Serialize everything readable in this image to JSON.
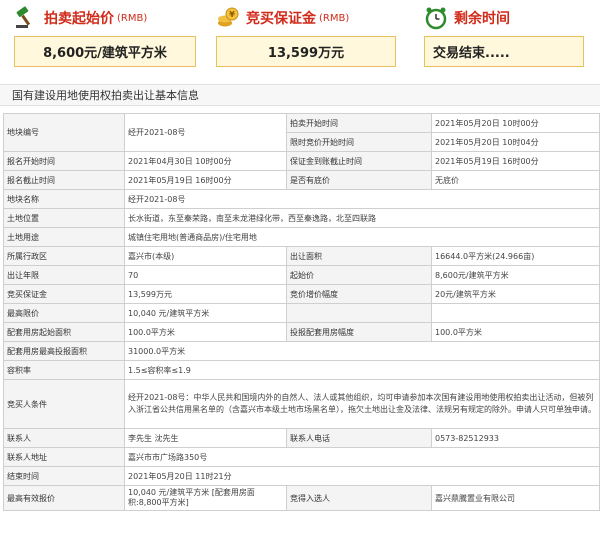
{
  "summary": {
    "start_price": {
      "title": "拍卖起始价",
      "unit": "(RMB)",
      "value": "8,600元/建筑平方米"
    },
    "deposit": {
      "title": "竞买保证金",
      "unit": "(RMB)",
      "value": "13,599万元"
    },
    "remaining": {
      "title": "剩余时间",
      "value": "交易结束....."
    }
  },
  "section_title": "国有建设用地使用权拍卖出让基本信息",
  "rows": [
    {
      "l1": "地块编号",
      "v1": "经开2021-08号",
      "l2": "拍卖开始时间",
      "v2": "2021年05月20日 10时00分"
    },
    {
      "l1": "",
      "v1": "",
      "l2": "限时竞价开始时间",
      "v2": "2021年05月20日 10时04分"
    },
    {
      "l1": "报名开始时间",
      "v1": "2021年04月30日 10时00分",
      "l2": "保证金到账截止时间",
      "v2": "2021年05月19日 16时00分"
    },
    {
      "l1": "报名截止时间",
      "v1": "2021年05月19日 16时00分",
      "l2": "是否有底价",
      "v2": "无底价"
    },
    {
      "l1": "地块名称",
      "v1": "经开2021-08号"
    },
    {
      "l1": "土地位置",
      "v1": "长水街道，东至秦荣路，南至未龙港绿化带，西至秦逸路，北至四联路"
    },
    {
      "l1": "土地用途",
      "v1": "城镇住宅用地(普通商品房)/住宅用地"
    },
    {
      "l1": "所属行政区",
      "v1": "嘉兴市(本级)",
      "l2": "出让面积",
      "v2": "16644.0平方米(24.966亩)"
    },
    {
      "l1": "出让年限",
      "v1": "70",
      "l2": "起始价",
      "v2": "8,600元/建筑平方米"
    },
    {
      "l1": "竞买保证金",
      "v1": "13,599万元",
      "l2": "竞价增价幅度",
      "v2": "20元/建筑平方米"
    },
    {
      "l1": "最高限价",
      "v1": "10,040 元/建筑平方米",
      "l2": "",
      "v2": ""
    },
    {
      "l1": "配套用房起始面积",
      "v1": "100.0平方米",
      "l2": "投报配套用房幅度",
      "v2": "100.0平方米"
    },
    {
      "l1": "配套用房最高投报面积",
      "v1": "31000.0平方米"
    },
    {
      "l1": "容积率",
      "v1": "1.5≤容积率≤1.9"
    },
    {
      "l1": "竞买人条件",
      "v1": "经开2021-08号：中华人民共和国境内外的自然人、法人或其他组织，均可申请参加本次国有建设用地使用权拍卖出让活动，但被列入浙江省公共信用黑名单的（含嘉兴市本级土地市场黑名单），拖欠土地出让金及法律、法规另有规定的除外。申请人只可单独申请。"
    },
    {
      "l1": "联系人",
      "v1": "李先生 沈先生",
      "l2": "联系人电话",
      "v2": "0573-82512933"
    },
    {
      "l1": "联系人地址",
      "v1": "嘉兴市市广场路350号"
    },
    {
      "l1": "结束时间",
      "v1": "2021年05月20日 11时21分"
    },
    {
      "l1": "最高有效报价",
      "v1": "10,040 元/建筑平方米 [配套用房面积:8,800平方米]",
      "l2": "竞得入选人",
      "v2": "嘉兴鼎騰置业有限公司"
    }
  ],
  "colors": {
    "accent_red": "#d12b1a",
    "box_border": "#e7c15d",
    "box_bg": "#fff8dc"
  }
}
